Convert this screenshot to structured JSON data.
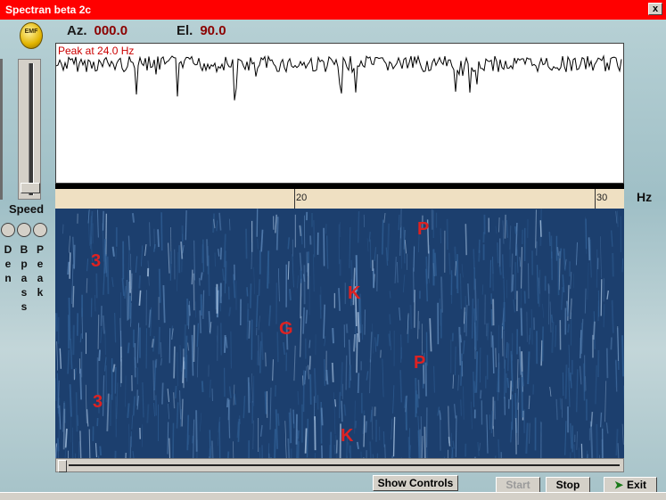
{
  "window": {
    "title": "Spectran beta 2c",
    "close_glyph": "x"
  },
  "header": {
    "az_label": "Az.",
    "az_value": "000.0",
    "el_label": "El.",
    "el_value": "90.0",
    "logo_text": "EMF"
  },
  "left_panel": {
    "speed_label": "Speed",
    "slider_level": 0.05,
    "radio_options": [
      {
        "label": "Den",
        "selected": false
      },
      {
        "label": "Bpass",
        "selected": false
      },
      {
        "label": "Peak",
        "selected": false
      }
    ]
  },
  "spectrum": {
    "peak_text": "Peak at  24.0 Hz"
  },
  "frequency_axis": {
    "unit_label": "Hz",
    "ticks": [
      {
        "value": 20,
        "label": "20"
      },
      {
        "value": 30,
        "label": "30"
      }
    ]
  },
  "waterfall": {
    "annotations": [
      "3",
      "P",
      "K",
      "G",
      "P",
      "3",
      "K"
    ]
  },
  "controls": {
    "show_controls": "Show Controls",
    "start": "Start",
    "stop": "Stop",
    "exit": "Exit"
  },
  "colors": {
    "title_bar": "#ff0000",
    "peak_text": "#cc0000",
    "waterfall_base": "#1c3f6e",
    "annotation": "#dd2222"
  }
}
